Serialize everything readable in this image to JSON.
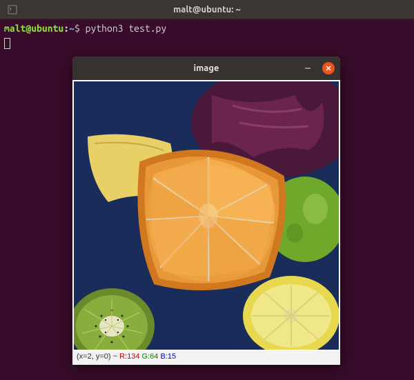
{
  "terminal": {
    "title": "malt@ubuntu: ~",
    "prompt_user": "malt@ubuntu",
    "prompt_path": "~",
    "prompt_symbol": "$",
    "command": "python3 test.py"
  },
  "image_window": {
    "title": "image",
    "status": {
      "coords": "(x=2, y=0) ~",
      "r_label": "R:",
      "r_value": "134",
      "g_label": "G:",
      "g_value": "64",
      "b_label": "B:",
      "b_value": "15"
    }
  }
}
